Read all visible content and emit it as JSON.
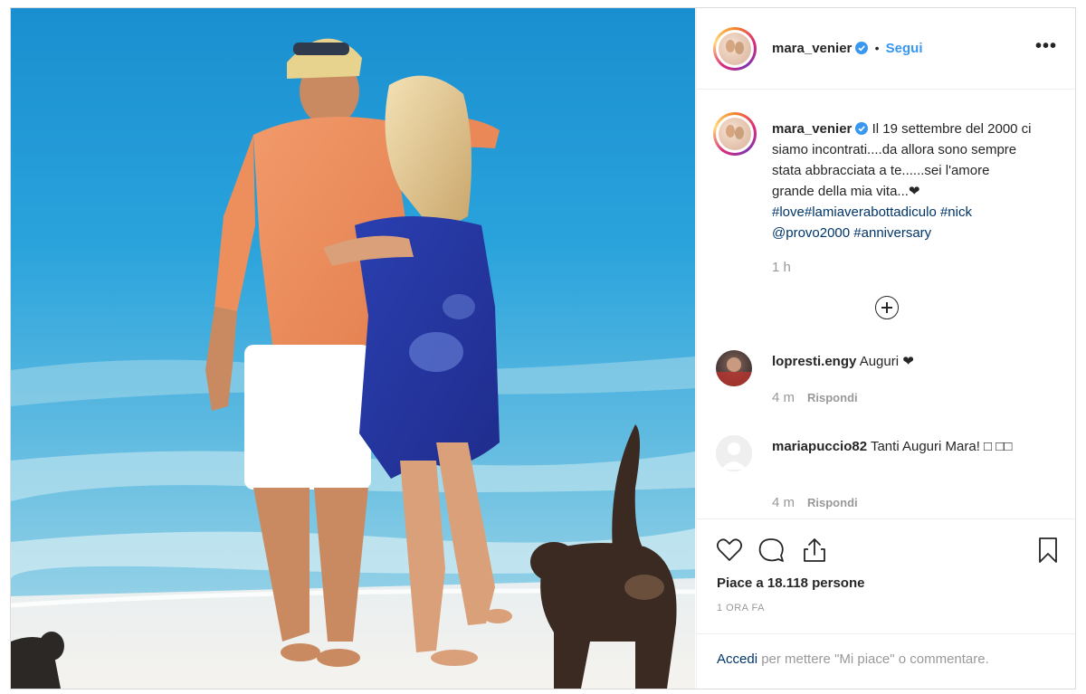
{
  "post": {
    "username": "mara_venier",
    "follow_label": "Segui",
    "more_label": "•••",
    "dot": "•"
  },
  "caption": {
    "username": "mara_venier",
    "text_part1": "Il 19 settembre del 2000 ci siamo incontrati....da allora sono sempre stata abbracciata a te......sei l'amore grande della mia vita...",
    "heart": "❤",
    "tag_love": "#love",
    "tag_lamia": "#lamiaverabottadiculo",
    "tag_nick": "#nick",
    "mention": "@provo2000",
    "tag_anniv": "#anniversary",
    "time": "1 h"
  },
  "comments": [
    {
      "username": "lopresti.engy",
      "text": "Auguri ❤",
      "time": "4 m",
      "reply_label": "Rispondi"
    },
    {
      "username": "mariapuccio82",
      "text": "Tanti Auguri Mara! □ □□",
      "time": "4 m",
      "reply_label": "Rispondi"
    }
  ],
  "actions": {
    "likes": "Piace a 18.118 persone",
    "ago": "1 ORA FA",
    "login_link": "Accedi",
    "login_rest": " per mettere \"Mi piace\" o commentare."
  },
  "colors": {
    "link_blue": "#3897f0",
    "hashtag": "#003569",
    "muted": "#999999",
    "text": "#262626"
  }
}
